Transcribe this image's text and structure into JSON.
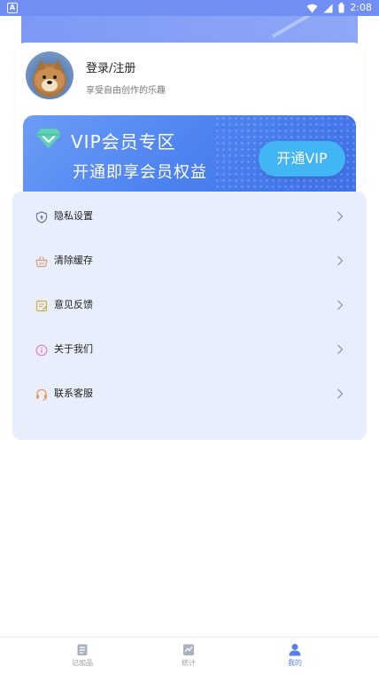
{
  "status_bar": {
    "time": "2:08"
  },
  "profile": {
    "title": "登录/注册",
    "subtitle": "享受自由创作的乐趣"
  },
  "vip": {
    "title": "VIP会员专区",
    "subtitle": "开通即享会员权益",
    "button": "开通VIP"
  },
  "menu": {
    "items": [
      {
        "label": "隐私设置",
        "icon": "shield-icon",
        "color": "#6b7a99"
      },
      {
        "label": "清除缓存",
        "icon": "basket-icon",
        "color": "#d9a07a"
      },
      {
        "label": "意见反馈",
        "icon": "feedback-icon",
        "color": "#d2ae3c"
      },
      {
        "label": "关于我们",
        "icon": "info-icon",
        "color": "#e57fc1"
      },
      {
        "label": "联系客服",
        "icon": "headset-icon",
        "color": "#e59a5a"
      }
    ]
  },
  "bottom_nav": {
    "items": [
      {
        "label": "记加品",
        "icon": "notebook-icon"
      },
      {
        "label": "统计",
        "icon": "chart-icon"
      },
      {
        "label": "我的",
        "icon": "person-icon"
      }
    ],
    "active_index": 2,
    "active_color": "#5a7fe6"
  }
}
